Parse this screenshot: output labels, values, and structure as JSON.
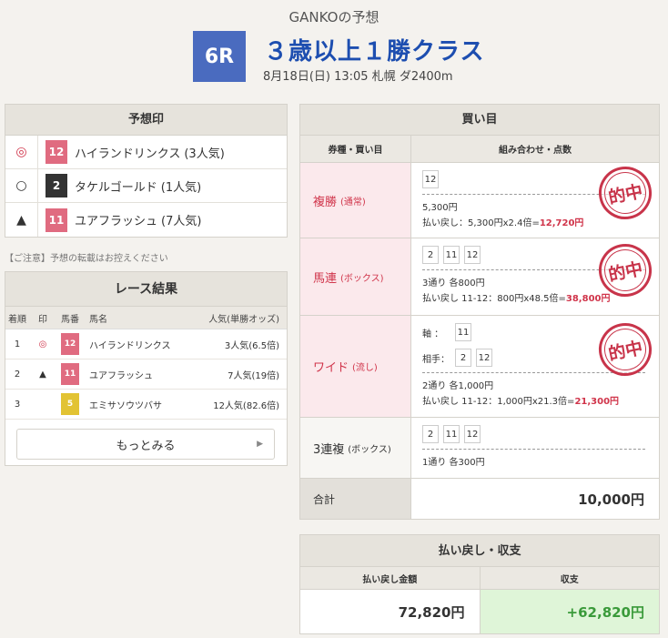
{
  "header": {
    "subtitle": "GANKOの予想",
    "race_number": "6R",
    "race_title": "３歳以上１勝クラス",
    "race_info": "8月18日(日) 13:05 札幌 ダ2400m"
  },
  "prediction": {
    "title": "予想印",
    "rows": [
      {
        "mark": "◎",
        "num": "12",
        "name": "ハイランドリンクス",
        "pop": "(3人気)"
      },
      {
        "mark": "○",
        "num": "2",
        "name": "タケルゴールド",
        "pop": "(1人気)"
      },
      {
        "mark": "▲",
        "num": "11",
        "name": "ユアフラッシュ",
        "pop": "(7人気)"
      }
    ]
  },
  "caution": "【ご注意】予想の転載はお控えください",
  "result": {
    "title": "レース結果",
    "headers": {
      "rank": "着順",
      "mark": "印",
      "num": "馬番",
      "name": "馬名",
      "pop": "人気(単勝オッズ)"
    },
    "rows": [
      {
        "rank": "1",
        "mark": "◎",
        "num": "12",
        "name": "ハイランドリンクス",
        "pop": "3人気(6.5倍)"
      },
      {
        "rank": "2",
        "mark": "▲",
        "num": "11",
        "name": "ユアフラッシュ",
        "pop": "7人気(19倍)"
      },
      {
        "rank": "3",
        "mark": "",
        "num": "5",
        "name": "エミサソウツバサ",
        "pop": "12人気(82.6倍)"
      }
    ],
    "more_label": "もっとみる"
  },
  "bets": {
    "title": "買い目",
    "col_type": "券種・買い目",
    "col_combo": "組み合わせ・点数",
    "stamp_text": "的中",
    "rows": {
      "fukusho": {
        "type": "複勝",
        "sub": "(通常)",
        "nums": [
          "12"
        ],
        "count": "5,300円",
        "ret_prefix": "払い戻し：5,300円x2.4倍=",
        "ret_amount": "12,720円"
      },
      "umaren": {
        "type": "馬連",
        "sub": "(ボックス)",
        "nums": [
          "2",
          "11",
          "12"
        ],
        "count": "3通り 各800円",
        "ret_prefix": "払い戻し 11-12：800円x48.5倍=",
        "ret_amount": "38,800円"
      },
      "wide": {
        "type": "ワイド",
        "sub": "(流し)",
        "axis_label": "軸 ：",
        "axis_nums": [
          "11"
        ],
        "partner_label": "相手：",
        "partner_nums": [
          "2",
          "12"
        ],
        "count": "2通り 各1,000円",
        "ret_prefix": "払い戻し 11-12：1,000円x21.3倍=",
        "ret_amount": "21,300円"
      },
      "sanrenpuku": {
        "type": "3連複",
        "sub": "(ボックス)",
        "nums": [
          "2",
          "11",
          "12"
        ],
        "count": "1通り 各300円"
      }
    },
    "total_label": "合計",
    "total_value": "10,000円"
  },
  "summary": {
    "title": "払い戻し・収支",
    "col_return": "払い戻し金額",
    "col_profit": "収支",
    "return_value": "72,820円",
    "profit_value": "+62,820円"
  },
  "colors": {
    "badge": "#4a6bbf",
    "title": "#1d4eb0",
    "hit_red": "#d0344a",
    "profit_green": "#3a9a3a"
  }
}
